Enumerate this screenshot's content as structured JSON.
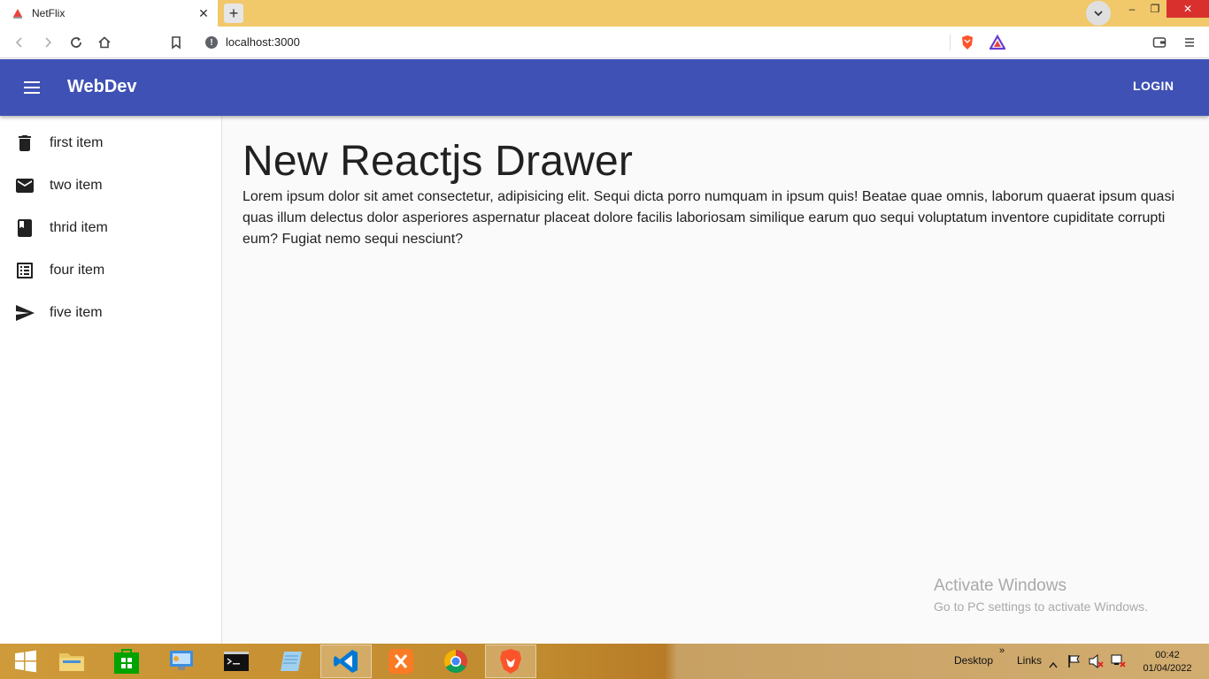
{
  "browser": {
    "tab": {
      "title": "NetFlix",
      "close_glyph": "✕"
    },
    "new_tab_glyph": "+",
    "window_controls": {
      "minimize": "–",
      "maximize": "❐",
      "close": "✕"
    },
    "address": {
      "url": "localhost:3000",
      "info_glyph": "!"
    }
  },
  "appbar": {
    "title": "WebDev",
    "login_label": "LOGIN",
    "color": "#3f51b5"
  },
  "drawer": {
    "items": [
      {
        "label": "first item",
        "icon": "delete-icon"
      },
      {
        "label": "two item",
        "icon": "mail-icon"
      },
      {
        "label": "thrid item",
        "icon": "book-icon"
      },
      {
        "label": "four item",
        "icon": "list-icon"
      },
      {
        "label": "five item",
        "icon": "send-icon"
      }
    ]
  },
  "main": {
    "heading": "New Reactjs Drawer",
    "body": "Lorem ipsum dolor sit amet consectetur, adipisicing elit. Sequi dicta porro numquam in ipsum quis! Beatae quae omnis, laborum quaerat ipsum quasi quas illum delectus dolor asperiores aspernatur placeat dolore facilis laboriosam similique earum quo sequi voluptatum inventore cupiditate corrupti eum? Fugiat nemo sequi nesciunt?"
  },
  "watermark": {
    "title": "Activate Windows",
    "subtitle": "Go to PC settings to activate Windows."
  },
  "taskbar": {
    "desktop_label": "Desktop",
    "links_label": "Links",
    "chevron_glyph": "»",
    "time": "00:42",
    "date": "01/04/2022"
  }
}
